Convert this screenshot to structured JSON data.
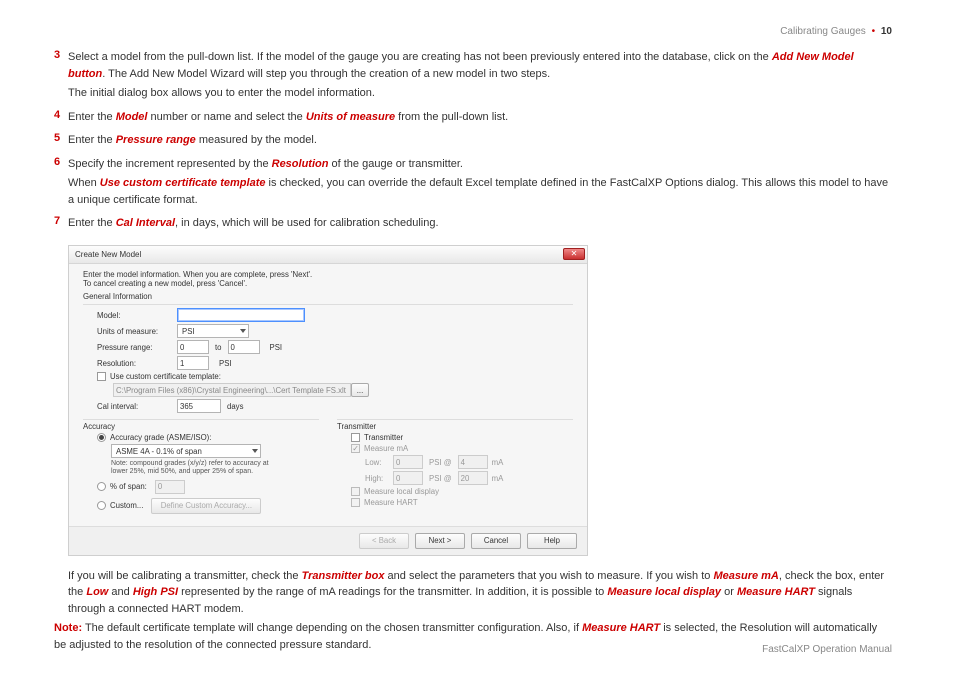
{
  "header": {
    "section": "Calibrating Gauges",
    "page": "10"
  },
  "steps": {
    "s3": {
      "num": "3",
      "t1": "Select a model from the pull-down list. If the model of the gauge you are creating has not been previously entered into the database, click on the ",
      "em1": "Add New Model button",
      "t2": ". The Add New Model Wizard will step you through the creation of a new model in two steps.",
      "t3": "The initial dialog box allows you to enter the model information."
    },
    "s4": {
      "num": "4",
      "t1": "Enter the ",
      "em1": "Model",
      "t2": " number or name and select the ",
      "em2": "Units of measure",
      "t3": " from the pull-down list."
    },
    "s5": {
      "num": "5",
      "t1": "Enter the ",
      "em1": "Pressure range",
      "t2": " measured by the model."
    },
    "s6": {
      "num": "6",
      "t1": "Specify the increment represented by the ",
      "em1": "Resolution",
      "t2": " of the gauge or transmitter.",
      "t3": "When ",
      "em3": "Use custom certificate template",
      "t4": " is checked, you can override the default Excel template defined in the FastCalXP Options dialog. This allows this model to have a unique certificate format."
    },
    "s7": {
      "num": "7",
      "t1": "Enter the ",
      "em1": "Cal Interval",
      "t2": ", in days, which will be used for calibration scheduling."
    }
  },
  "dialog": {
    "title": "Create New Model",
    "instr1": "Enter the model information. When you are complete, press 'Next'.",
    "instr2": "To cancel creating a new model, press 'Cancel'.",
    "gi": {
      "heading": "General Information",
      "model_label": "Model:",
      "model_value": "",
      "uom_label": "Units of measure:",
      "uom_value": "PSI",
      "pr_label": "Pressure range:",
      "pr_low": "0",
      "pr_to": "to",
      "pr_high": "0",
      "pr_unit": "PSI",
      "res_label": "Resolution:",
      "res_value": "1",
      "res_unit": "PSI",
      "chk_cert": "Use custom certificate template:",
      "cert_path": "C:\\Program Files (x86)\\Crystal Engineering\\...\\Cert Template FS.xlt",
      "browse": "...",
      "cal_label": "Cal interval:",
      "cal_value": "365",
      "cal_unit": "days"
    },
    "accuracy": {
      "heading": "Accuracy",
      "r1": "Accuracy grade (ASME/ISO):",
      "grade": "ASME 4A - 0.1% of span",
      "note": "Note: compound grades (x/y/z) refer to accuracy at lower 25%, mid 50%, and upper 25% of span.",
      "r2": "% of span:",
      "r3": "Custom...",
      "span_val": "0",
      "btn": "Define Custom Accuracy..."
    },
    "tx": {
      "heading": "Transmitter",
      "chk1": "Transmitter",
      "chk2": "Measure mA",
      "low_label": "Low:",
      "low_val": "0",
      "low_psi": "PSI @",
      "low_ma": "4",
      "ma": "mA",
      "high_label": "High:",
      "high_val": "0",
      "high_psi": "PSI @",
      "high_ma": "20",
      "chk3": "Measure local display",
      "chk4": "Measure HART"
    },
    "buttons": {
      "back": "< Back",
      "next": "Next >",
      "cancel": "Cancel",
      "help": "Help"
    }
  },
  "post": {
    "p1a": "If you will be calibrating a transmitter, check the ",
    "em1": "Transmitter box",
    "p1b": " and select the parameters that you wish to measure. If you wish to ",
    "em2": "Measure mA",
    "p1c": ", check the box, enter the ",
    "em3": "Low",
    "p1d": " and ",
    "em4": "High PSI",
    "p1e": " represented by the range of mA readings for the transmitter. In addition, it is possible to ",
    "em5": "Measure local display",
    "p1f": " or ",
    "em6": "Measure HART",
    "p1g": " signals through a connected HART modem."
  },
  "note": {
    "label": "Note:",
    "t1": " The default certificate template will change depending on the chosen transmitter configuration. Also, if ",
    "em1": "Measure HART",
    "t2": " is selected, the Resolution will automatically be adjusted to the resolution of the connected pressure standard."
  },
  "footer": "FastCalXP Operation Manual"
}
